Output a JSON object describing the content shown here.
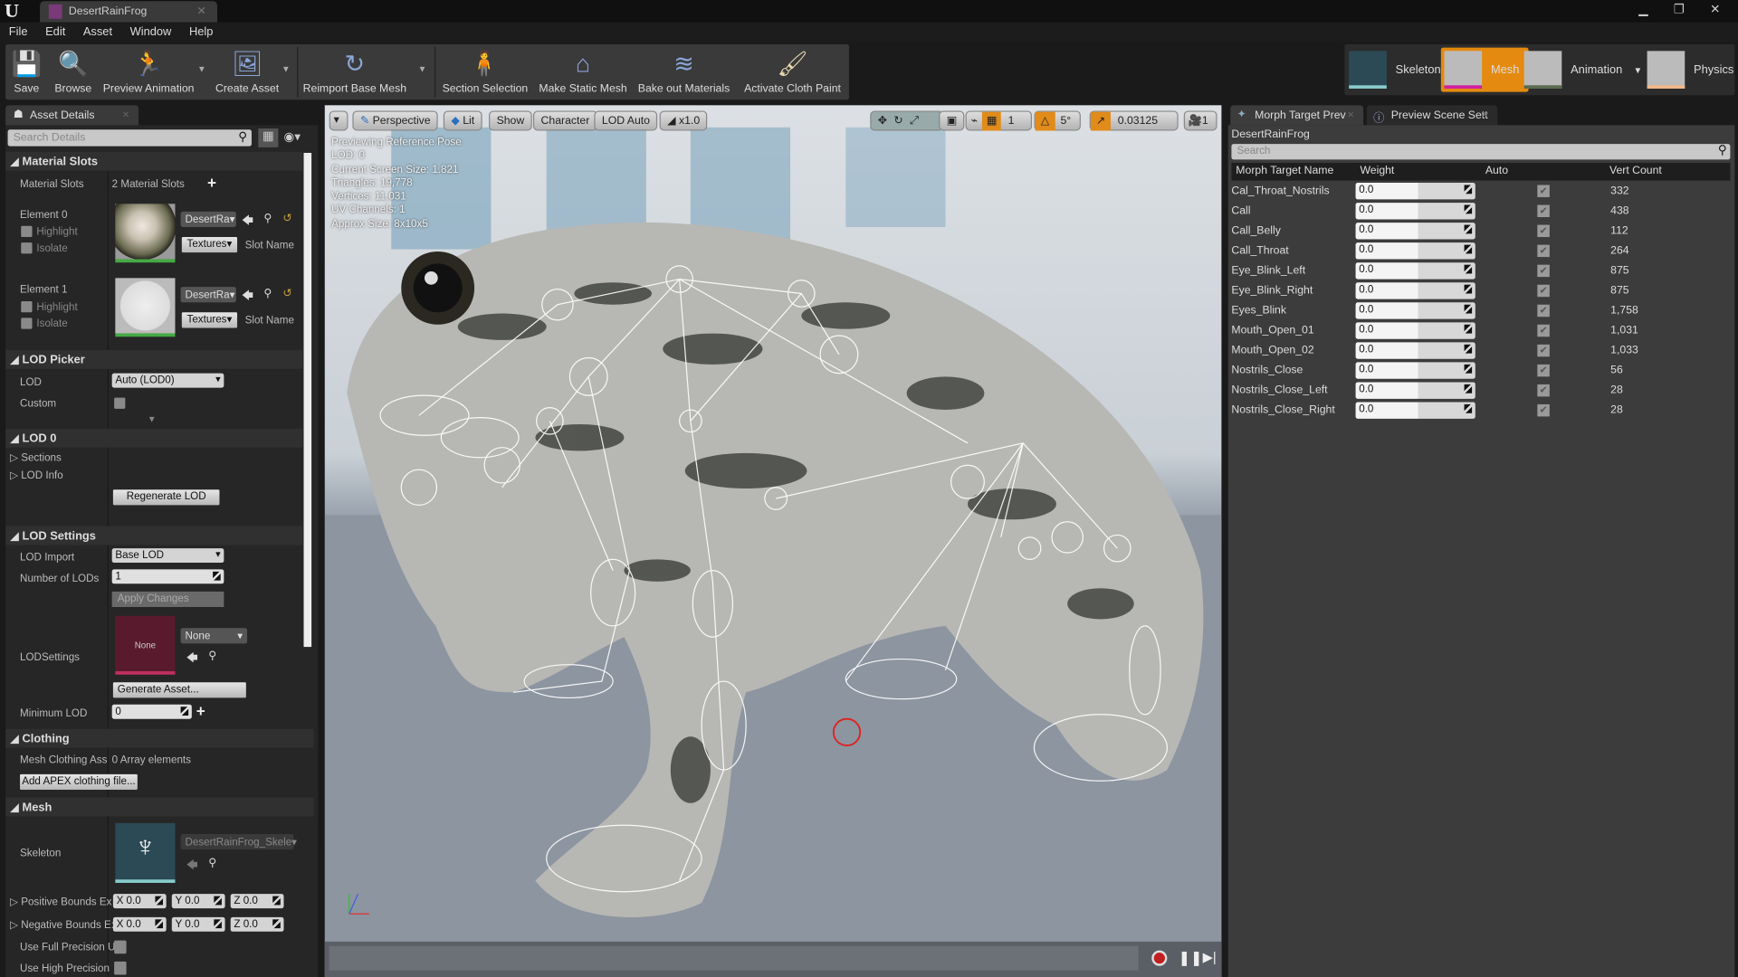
{
  "window": {
    "app_logo": "U",
    "doc_tab": "DesertRainFrog",
    "controls": "▁ ❐ ✕"
  },
  "menu": [
    "File",
    "Edit",
    "Asset",
    "Window",
    "Help"
  ],
  "toolbar": [
    {
      "label": "Save",
      "icon": "save-icon"
    },
    {
      "label": "Browse",
      "icon": "browse-icon"
    },
    {
      "label": "Preview Animation",
      "icon": "preview-animation-icon",
      "dropdown": true
    },
    {
      "label": "Create Asset",
      "icon": "create-asset-icon",
      "dropdown": true
    },
    {
      "label": "Reimport Base Mesh",
      "icon": "reimport-icon",
      "dropdown": true
    },
    {
      "label": "Section Selection",
      "icon": "section-selection-icon"
    },
    {
      "label": "Make Static Mesh",
      "icon": "make-static-mesh-icon"
    },
    {
      "label": "Bake out Materials",
      "icon": "bake-materials-icon"
    },
    {
      "label": "Activate Cloth Paint",
      "icon": "cloth-paint-icon"
    }
  ],
  "asset_modes": [
    {
      "label": "Skeleton"
    },
    {
      "label": "Mesh",
      "active": true
    },
    {
      "label": "Animation"
    },
    {
      "label": "Physics"
    }
  ],
  "details": {
    "tab": "Asset Details",
    "search_placeholder": "Search Details",
    "material_slots": {
      "header": "Material Slots",
      "label": "Material Slots",
      "count": "2 Material Slots",
      "elements": [
        {
          "name": "Element 0",
          "highlight": "Highlight",
          "isolate": "Isolate",
          "material": "DesertRa",
          "textures": "Textures",
          "slot_name": "Slot Name"
        },
        {
          "name": "Element 1",
          "highlight": "Highlight",
          "isolate": "Isolate",
          "material": "DesertRa",
          "textures": "Textures",
          "slot_name": "Slot Name"
        }
      ]
    },
    "lod_picker": {
      "header": "LOD Picker",
      "lod_label": "LOD",
      "lod_value": "Auto (LOD0)",
      "custom_label": "Custom"
    },
    "lod0": {
      "header": "LOD 0",
      "sections": "Sections",
      "lod_info": "LOD Info",
      "regenerate": "Regenerate LOD"
    },
    "lod_settings": {
      "header": "LOD Settings",
      "import_label": "LOD Import",
      "import_value": "Base LOD",
      "num_label": "Number of LODs",
      "num_value": "1",
      "apply": "Apply Changes",
      "settings_label": "LODSettings",
      "thumb_text": "None",
      "settings_value": "None",
      "generate": "Generate Asset...",
      "min_label": "Minimum LOD",
      "min_value": "0"
    },
    "clothing": {
      "header": "Clothing",
      "assets_label": "Mesh Clothing Ass",
      "assets_value": "0 Array elements",
      "add": "Add APEX clothing file..."
    },
    "mesh": {
      "header": "Mesh",
      "skeleton_label": "Skeleton",
      "skeleton_value": "DesertRainFrog_Skele",
      "pos_label": "Positive Bounds Ex",
      "neg_label": "Negative Bounds E:",
      "pos": {
        "x": "X  0.0",
        "y": "Y  0.0",
        "z": "Z  0.0"
      },
      "neg": {
        "x": "X  0.0",
        "y": "Y  0.0",
        "z": "Z  0.0"
      },
      "full_precision": "Use Full Precision U",
      "high_precision": "Use High Precision"
    }
  },
  "viewport": {
    "buttons": {
      "perspective": "Perspective",
      "lit": "Lit",
      "show": "Show",
      "character": "Character",
      "lod": "LOD Auto",
      "speed": "x1.0"
    },
    "snap": {
      "grid": "1",
      "angle": "5°",
      "scale": "0.03125",
      "camera_speed": "1"
    },
    "info": [
      "Previewing Reference Pose",
      "LOD: 0",
      "Current Screen Size: 1.821",
      "Triangles: 19,778",
      "Vertices: 11,031",
      "UV Channels: 1",
      "Approx Size: 8x10x5"
    ]
  },
  "morph": {
    "tabs": [
      "Morph Target Prev",
      "Preview Scene Sett"
    ],
    "asset": "DesertRainFrog",
    "search_placeholder": "Search",
    "columns": [
      "Morph Target Name",
      "Weight",
      "Auto",
      "Vert Count"
    ],
    "rows": [
      {
        "name": "Cal_Throat_Nostrils",
        "weight": "0.0",
        "auto": true,
        "verts": "332"
      },
      {
        "name": "Call",
        "weight": "0.0",
        "auto": true,
        "verts": "438"
      },
      {
        "name": "Call_Belly",
        "weight": "0.0",
        "auto": true,
        "verts": "112"
      },
      {
        "name": "Call_Throat",
        "weight": "0.0",
        "auto": true,
        "verts": "264"
      },
      {
        "name": "Eye_Blink_Left",
        "weight": "0.0",
        "auto": true,
        "verts": "875"
      },
      {
        "name": "Eye_Blink_Right",
        "weight": "0.0",
        "auto": true,
        "verts": "875"
      },
      {
        "name": "Eyes_Blink",
        "weight": "0.0",
        "auto": true,
        "verts": "1,758"
      },
      {
        "name": "Mouth_Open_01",
        "weight": "0.0",
        "auto": true,
        "verts": "1,031"
      },
      {
        "name": "Mouth_Open_02",
        "weight": "0.0",
        "auto": true,
        "verts": "1,033"
      },
      {
        "name": "Nostrils_Close",
        "weight": "0.0",
        "auto": true,
        "verts": "56"
      },
      {
        "name": "Nostrils_Close_Left",
        "weight": "0.0",
        "auto": true,
        "verts": "28"
      },
      {
        "name": "Nostrils_Close_Right",
        "weight": "0.0",
        "auto": true,
        "verts": "28"
      }
    ]
  },
  "colors": {
    "accent": "#e08b1a",
    "mesh_active": "#e48a10",
    "lod_thumb": "#5a1a2e"
  }
}
